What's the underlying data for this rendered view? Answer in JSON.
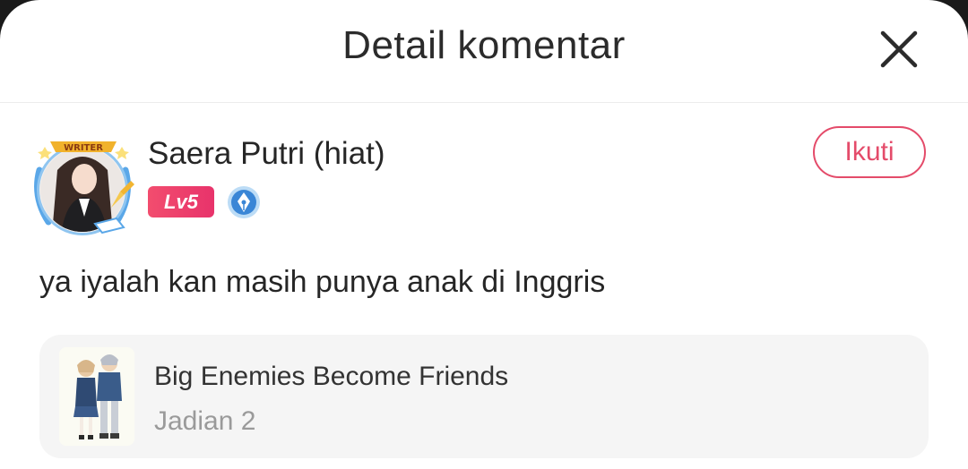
{
  "header": {
    "title": "Detail komentar",
    "close_icon": "close-icon"
  },
  "comment": {
    "author": {
      "name": "Saera Putri (hiat)",
      "level": "Lv5",
      "avatar_badge_text": "WRITER",
      "writer_badge_icon": "pen-nib-icon"
    },
    "follow_label": "Ikuti",
    "text": "ya iyalah kan masih punya anak di Inggris"
  },
  "book": {
    "title": "Big Enemies Become Friends",
    "chapter": "Jadian 2"
  },
  "colors": {
    "accent": "#e44b6a",
    "level_badge": "#f04468",
    "writer_blue": "#3a86d6",
    "card_bg": "#f5f5f5"
  }
}
